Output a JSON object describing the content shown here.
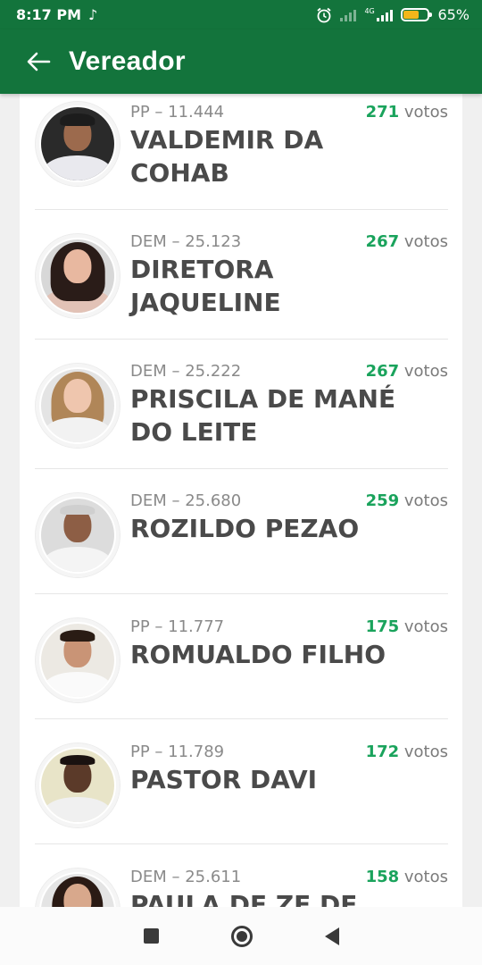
{
  "status": {
    "time": "8:17 PM",
    "tiktok_glyph": "♪",
    "battery_pct": "65%",
    "battery_level": 0.65,
    "network": "4G"
  },
  "app_bar": {
    "title": "Vereador"
  },
  "candidates": [
    {
      "party": "PP – 11.444",
      "votes": "271",
      "votes_word": "votos",
      "name": "VALDEMIR DA COHAB"
    },
    {
      "party": "DEM – 25.123",
      "votes": "267",
      "votes_word": "votos",
      "name": "DIRETORA JAQUELINE"
    },
    {
      "party": "DEM – 25.222",
      "votes": "267",
      "votes_word": "votos",
      "name": "PRISCILA DE MANÉ DO LEITE"
    },
    {
      "party": "DEM – 25.680",
      "votes": "259",
      "votes_word": "votos",
      "name": "ROZILDO PEZAO"
    },
    {
      "party": "PP – 11.777",
      "votes": "175",
      "votes_word": "votos",
      "name": "ROMUALDO FILHO"
    },
    {
      "party": "PP – 11.789",
      "votes": "172",
      "votes_word": "votos",
      "name": "PASTOR DAVI"
    },
    {
      "party": "DEM – 25.611",
      "votes": "158",
      "votes_word": "votos",
      "name": "PAULA DE ZE DE"
    }
  ],
  "colors": {
    "brand_green": "#13743c",
    "votes_green": "#1aa35c",
    "name_text": "#4a4a4a"
  },
  "nav": {
    "recents": "square-icon",
    "home": "circle-icon",
    "back": "triangle-back-icon"
  }
}
